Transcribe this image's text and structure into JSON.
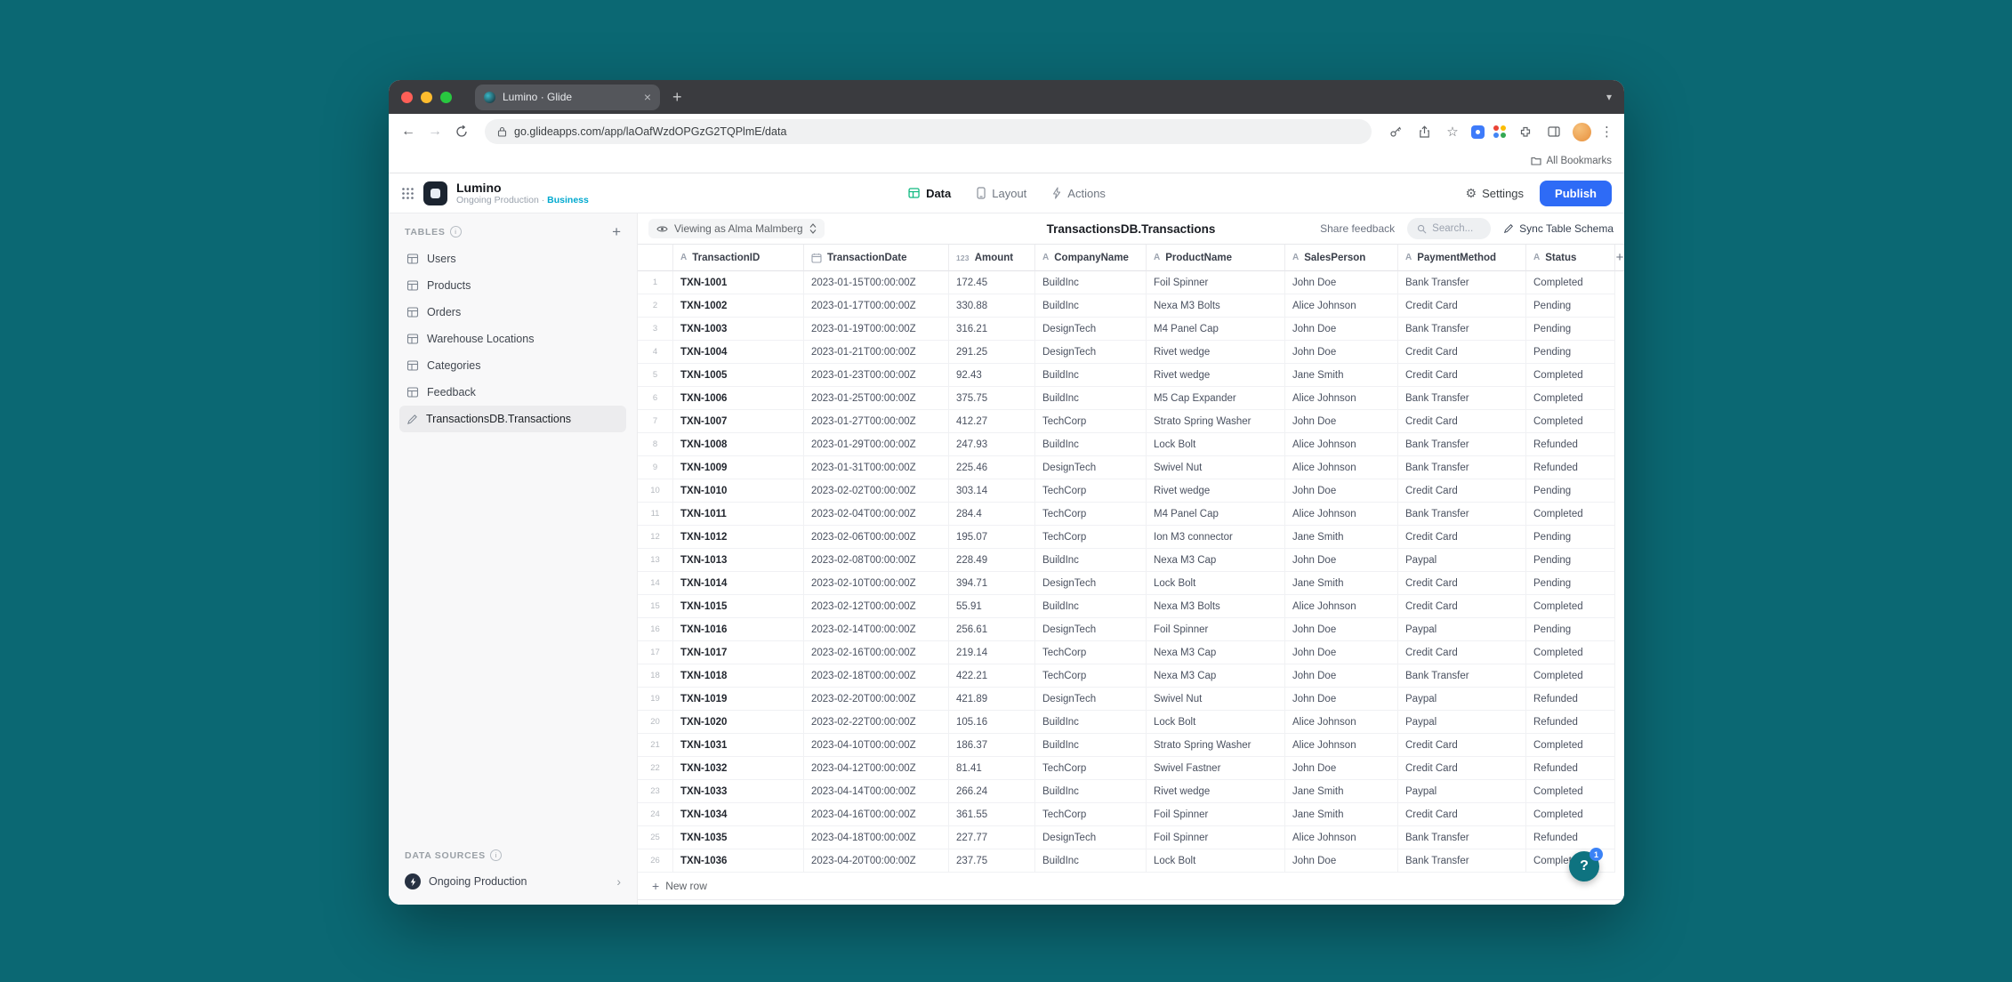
{
  "browser": {
    "tab_title": "Lumino · Glide",
    "url": "go.glideapps.com/app/laOafWzdOPGzG2TQPlmE/data",
    "bookmarks_label": "All Bookmarks"
  },
  "app_header": {
    "app_name": "Lumino",
    "app_subtitle": "Ongoing Production",
    "subtitle_separator": "·",
    "app_plan": "Business",
    "tabs": [
      {
        "label": "Data",
        "icon": "data-grid-icon",
        "active": true
      },
      {
        "label": "Layout",
        "icon": "layout-phone-icon",
        "active": false
      },
      {
        "label": "Actions",
        "icon": "actions-bolt-icon",
        "active": false
      }
    ],
    "settings_label": "Settings",
    "publish_label": "Publish"
  },
  "sidebar": {
    "tables_label": "TABLES",
    "items": [
      {
        "label": "Users",
        "icon": "table-grid-icon",
        "selected": false
      },
      {
        "label": "Products",
        "icon": "table-grid-icon",
        "selected": false
      },
      {
        "label": "Orders",
        "icon": "table-grid-icon",
        "selected": false
      },
      {
        "label": "Warehouse Locations",
        "icon": "table-grid-icon",
        "selected": false
      },
      {
        "label": "Categories",
        "icon": "table-grid-icon",
        "selected": false
      },
      {
        "label": "Feedback",
        "icon": "table-grid-icon",
        "selected": false
      },
      {
        "label": "TransactionsDB.Transactions",
        "icon": "pencil-icon",
        "selected": true
      }
    ],
    "data_sources_label": "DATA SOURCES",
    "data_source": "Ongoing Production"
  },
  "toolbar": {
    "viewing_as": "Viewing as Alma Malmberg",
    "table_title": "TransactionsDB.Transactions",
    "share_feedback": "Share feedback",
    "search_placeholder": "Search...",
    "sync_label": "Sync Table Schema"
  },
  "table": {
    "new_row_label": "New row",
    "columns": [
      {
        "name": "TransactionID",
        "type": "text"
      },
      {
        "name": "TransactionDate",
        "type": "date"
      },
      {
        "name": "Amount",
        "type": "number"
      },
      {
        "name": "CompanyName",
        "type": "text"
      },
      {
        "name": "ProductName",
        "type": "text"
      },
      {
        "name": "SalesPerson",
        "type": "text"
      },
      {
        "name": "PaymentMethod",
        "type": "text"
      },
      {
        "name": "Status",
        "type": "text"
      }
    ],
    "rows": [
      [
        "TXN-1001",
        "2023-01-15T00:00:00Z",
        "172.45",
        "BuildInc",
        "Foil Spinner",
        "John Doe",
        "Bank Transfer",
        "Completed"
      ],
      [
        "TXN-1002",
        "2023-01-17T00:00:00Z",
        "330.88",
        "BuildInc",
        "Nexa M3 Bolts",
        "Alice Johnson",
        "Credit Card",
        "Pending"
      ],
      [
        "TXN-1003",
        "2023-01-19T00:00:00Z",
        "316.21",
        "DesignTech",
        "M4 Panel Cap",
        "John Doe",
        "Bank Transfer",
        "Pending"
      ],
      [
        "TXN-1004",
        "2023-01-21T00:00:00Z",
        "291.25",
        "DesignTech",
        "Rivet wedge",
        "John Doe",
        "Credit Card",
        "Pending"
      ],
      [
        "TXN-1005",
        "2023-01-23T00:00:00Z",
        "92.43",
        "BuildInc",
        "Rivet wedge",
        "Jane Smith",
        "Credit Card",
        "Completed"
      ],
      [
        "TXN-1006",
        "2023-01-25T00:00:00Z",
        "375.75",
        "BuildInc",
        "M5 Cap Expander",
        "Alice Johnson",
        "Bank Transfer",
        "Completed"
      ],
      [
        "TXN-1007",
        "2023-01-27T00:00:00Z",
        "412.27",
        "TechCorp",
        "Strato Spring Washer",
        "John Doe",
        "Credit Card",
        "Completed"
      ],
      [
        "TXN-1008",
        "2023-01-29T00:00:00Z",
        "247.93",
        "BuildInc",
        "Lock Bolt",
        "Alice Johnson",
        "Bank Transfer",
        "Refunded"
      ],
      [
        "TXN-1009",
        "2023-01-31T00:00:00Z",
        "225.46",
        "DesignTech",
        "Swivel Nut",
        "Alice Johnson",
        "Bank Transfer",
        "Refunded"
      ],
      [
        "TXN-1010",
        "2023-02-02T00:00:00Z",
        "303.14",
        "TechCorp",
        "Rivet wedge",
        "John Doe",
        "Credit Card",
        "Pending"
      ],
      [
        "TXN-1011",
        "2023-02-04T00:00:00Z",
        "284.4",
        "TechCorp",
        "M4 Panel Cap",
        "Alice Johnson",
        "Bank Transfer",
        "Completed"
      ],
      [
        "TXN-1012",
        "2023-02-06T00:00:00Z",
        "195.07",
        "TechCorp",
        "Ion M3 connector",
        "Jane Smith",
        "Credit Card",
        "Pending"
      ],
      [
        "TXN-1013",
        "2023-02-08T00:00:00Z",
        "228.49",
        "BuildInc",
        "Nexa M3 Cap",
        "John Doe",
        "Paypal",
        "Pending"
      ],
      [
        "TXN-1014",
        "2023-02-10T00:00:00Z",
        "394.71",
        "DesignTech",
        "Lock Bolt",
        "Jane Smith",
        "Credit Card",
        "Pending"
      ],
      [
        "TXN-1015",
        "2023-02-12T00:00:00Z",
        "55.91",
        "BuildInc",
        "Nexa M3 Bolts",
        "Alice Johnson",
        "Credit Card",
        "Completed"
      ],
      [
        "TXN-1016",
        "2023-02-14T00:00:00Z",
        "256.61",
        "DesignTech",
        "Foil Spinner",
        "John Doe",
        "Paypal",
        "Pending"
      ],
      [
        "TXN-1017",
        "2023-02-16T00:00:00Z",
        "219.14",
        "TechCorp",
        "Nexa M3 Cap",
        "John Doe",
        "Credit Card",
        "Completed"
      ],
      [
        "TXN-1018",
        "2023-02-18T00:00:00Z",
        "422.21",
        "TechCorp",
        "Nexa M3 Cap",
        "John Doe",
        "Bank Transfer",
        "Completed"
      ],
      [
        "TXN-1019",
        "2023-02-20T00:00:00Z",
        "421.89",
        "DesignTech",
        "Swivel Nut",
        "John Doe",
        "Paypal",
        "Refunded"
      ],
      [
        "TXN-1020",
        "2023-02-22T00:00:00Z",
        "105.16",
        "BuildInc",
        "Lock Bolt",
        "Alice Johnson",
        "Paypal",
        "Refunded"
      ],
      [
        "TXN-1031",
        "2023-04-10T00:00:00Z",
        "186.37",
        "BuildInc",
        "Strato Spring Washer",
        "Alice Johnson",
        "Credit Card",
        "Completed"
      ],
      [
        "TXN-1032",
        "2023-04-12T00:00:00Z",
        "81.41",
        "TechCorp",
        "Swivel Fastner",
        "John Doe",
        "Credit Card",
        "Refunded"
      ],
      [
        "TXN-1033",
        "2023-04-14T00:00:00Z",
        "266.24",
        "BuildInc",
        "Rivet wedge",
        "Jane Smith",
        "Paypal",
        "Completed"
      ],
      [
        "TXN-1034",
        "2023-04-16T00:00:00Z",
        "361.55",
        "TechCorp",
        "Foil Spinner",
        "Jane Smith",
        "Credit Card",
        "Completed"
      ],
      [
        "TXN-1035",
        "2023-04-18T00:00:00Z",
        "227.77",
        "DesignTech",
        "Foil Spinner",
        "Alice Johnson",
        "Bank Transfer",
        "Refunded"
      ],
      [
        "TXN-1036",
        "2023-04-20T00:00:00Z",
        "237.75",
        "BuildInc",
        "Lock Bolt",
        "John Doe",
        "Bank Transfer",
        "Completed"
      ]
    ]
  },
  "help": {
    "question_mark": "?",
    "badge": "1"
  },
  "colors": {
    "desktop_bg": "#0b6873",
    "publish_blue": "#2e6bf6",
    "plan_cyan": "#00a9cf",
    "data_tab_green": "#10b981",
    "help_teal": "#0e7380"
  }
}
